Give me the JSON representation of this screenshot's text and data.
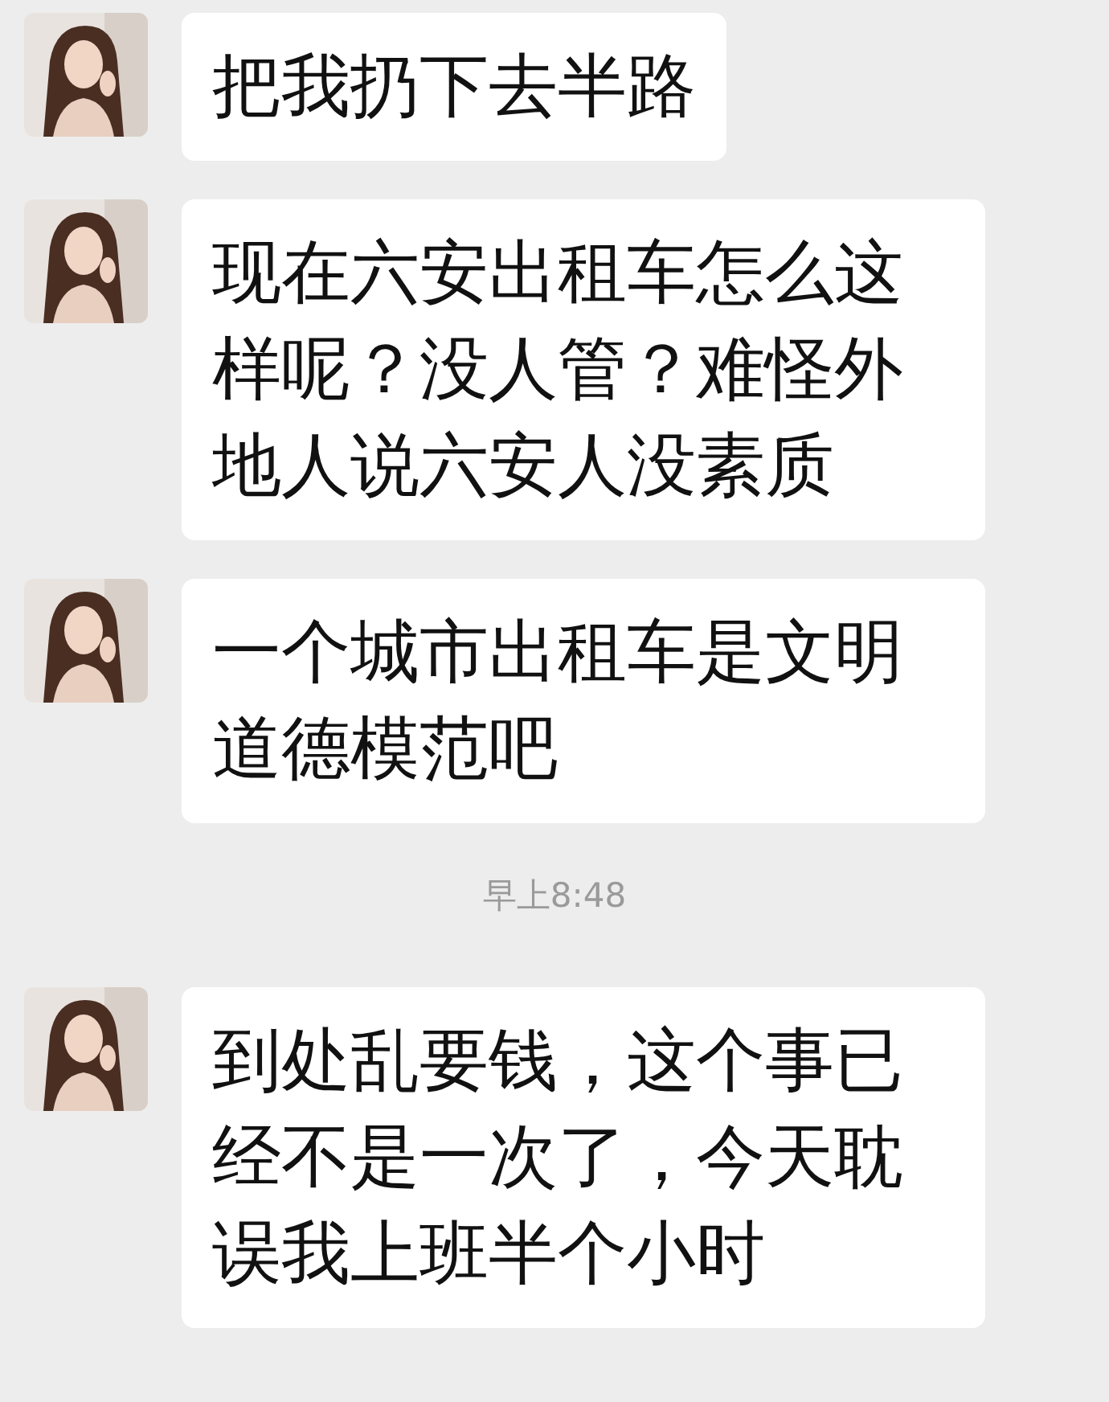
{
  "messages": [
    {
      "kind": "message",
      "text": "把我扔下去半路"
    },
    {
      "kind": "message",
      "text": "现在六安出租车怎么这样呢？没人管？难怪外地人说六安人没素质"
    },
    {
      "kind": "message",
      "text": "一个城市出租车是文明道德模范吧"
    },
    {
      "kind": "time",
      "text": "早上8:48"
    },
    {
      "kind": "message",
      "text": "到处乱要钱，这个事已经不是一次了，今天耽误我上班半个小时"
    }
  ]
}
